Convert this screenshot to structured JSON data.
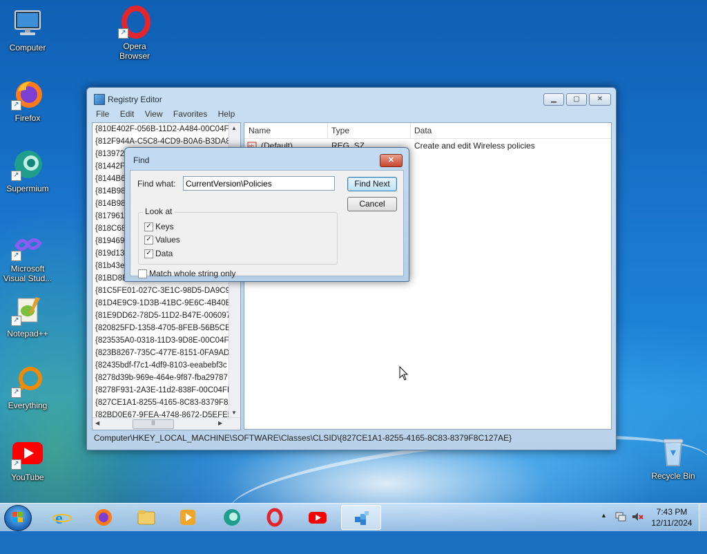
{
  "desktop": {
    "icons": [
      {
        "label": "Computer"
      },
      {
        "label": "Opera Browser"
      },
      {
        "label": "Firefox"
      },
      {
        "label": "Supermium"
      },
      {
        "label": "Microsoft Visual Stud..."
      },
      {
        "label": "Notepad++"
      },
      {
        "label": "Everything"
      },
      {
        "label": "YouTube"
      },
      {
        "label": "Recycle Bin"
      }
    ]
  },
  "window": {
    "title": "Registry Editor",
    "menu": [
      "File",
      "Edit",
      "View",
      "Favorites",
      "Help"
    ],
    "tree_items": [
      "{810E402F-056B-11D2-A484-00C04F8",
      "{812F944A-C5C8-4CD9-B0A6-B3DA8",
      "{8139720",
      "{81442F6",
      "{8144B6F",
      "{814B980",
      "{814B980",
      "{8179617",
      "{818C68",
      "{819469D",
      "{819d133",
      "{81b43e7",
      "{81BD8E",
      "{81C5FE01-027C-3E1C-98D5-DA9C98",
      "{81D4E9C9-1D3B-41BC-9E6C-4B40BF",
      "{81E9DD62-78D5-11D2-B47E-006097E",
      "{820825FD-1358-4705-8FEB-56B5CEE",
      "{823535A0-0318-11D3-9D8E-00C04F7",
      "{823B8267-735C-477E-8151-0FA9AD0",
      "{82435bdf-f7c1-4df9-8103-eeabebf3c",
      "{8278d39b-969e-464e-9f87-fba29787",
      "{8278F931-2A3E-11d2-838F-00C04FD",
      "{827CE1A1-8255-4165-8C83-8379F8C",
      "{82BD0E67-9FEA-4748-8672-D5EFE5B"
    ],
    "columns": {
      "name": "Name",
      "type": "Type",
      "data": "Data"
    },
    "value_row": {
      "name": "(Default)",
      "type": "REG_SZ",
      "data": "Create and edit Wireless policies"
    },
    "status_path": "Computer\\HKEY_LOCAL_MACHINE\\SOFTWARE\\Classes\\CLSID\\{827CE1A1-8255-4165-8C83-8379F8C127AE}"
  },
  "find_dialog": {
    "title": "Find",
    "find_what_label": "Find what:",
    "find_what_value": "CurrentVersion\\Policies",
    "find_next_label": "Find Next",
    "cancel_label": "Cancel",
    "look_at_label": "Look at",
    "keys_label": "Keys",
    "values_label": "Values",
    "data_label": "Data",
    "match_whole_label": "Match whole string only",
    "keys_checked": true,
    "values_checked": true,
    "data_checked": true,
    "match_whole_checked": false
  },
  "taskbar": {
    "time": "7:43 PM",
    "date": "12/11/2024"
  }
}
